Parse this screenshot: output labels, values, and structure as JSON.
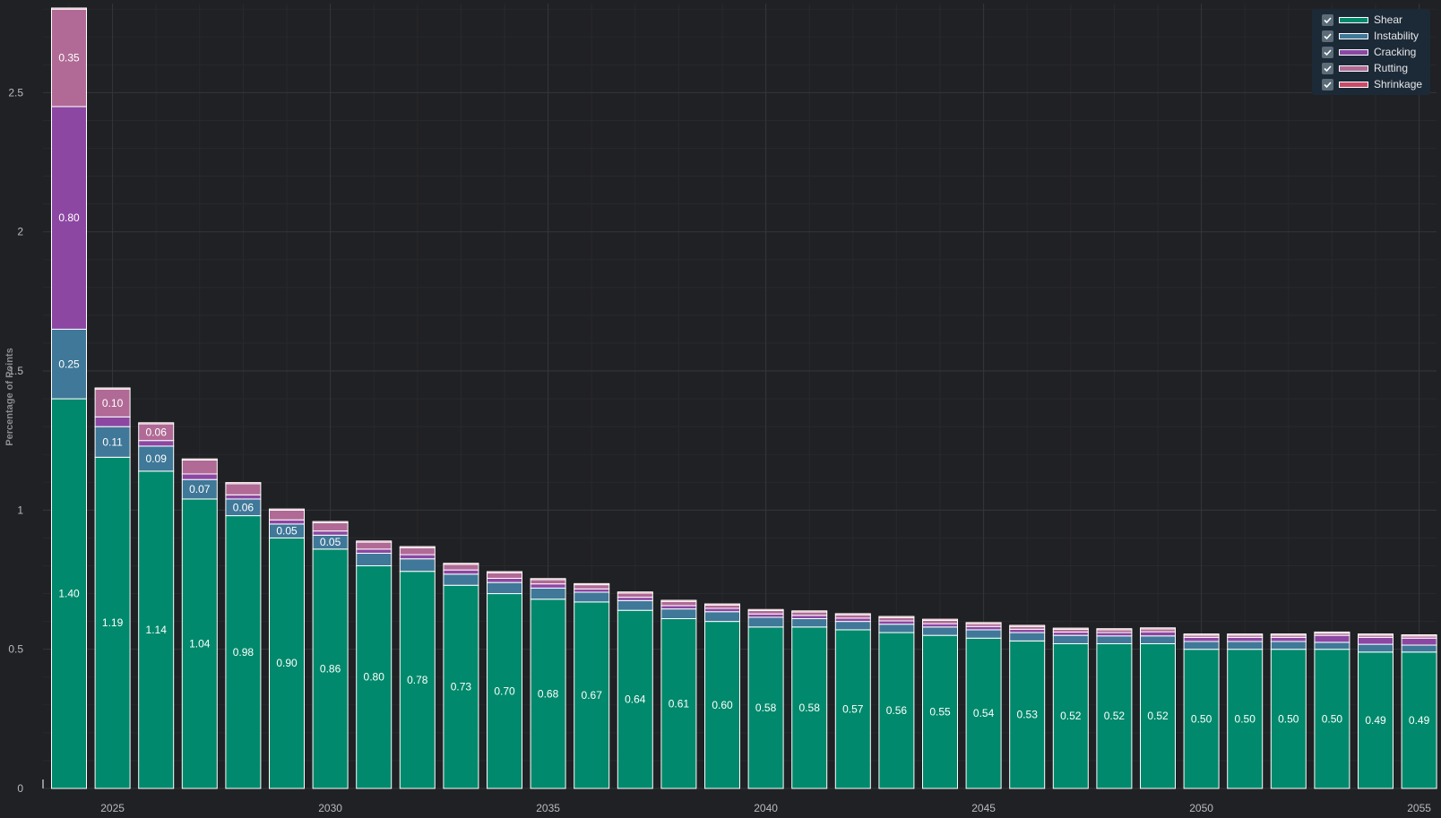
{
  "chart_data": {
    "type": "bar",
    "stacked": true,
    "ylabel": "Percentage of Points",
    "xlabel": "",
    "ylim": [
      0,
      2.82
    ],
    "yticks": [
      0,
      0.5,
      1,
      1.5,
      2,
      2.5
    ],
    "ytick_labels": [
      "0",
      "0.5",
      "1",
      "1.5",
      "2",
      "2.5"
    ],
    "xticks": [
      2025,
      2030,
      2035,
      2040,
      2045,
      2050,
      2055
    ],
    "categories": [
      2024,
      2025,
      2026,
      2027,
      2028,
      2029,
      2030,
      2031,
      2032,
      2033,
      2034,
      2035,
      2036,
      2037,
      2038,
      2039,
      2040,
      2041,
      2042,
      2043,
      2044,
      2045,
      2046,
      2047,
      2048,
      2049,
      2050,
      2051,
      2052,
      2053,
      2054,
      2055
    ],
    "series": [
      {
        "name": "Shear",
        "color": "#00896c",
        "values": [
          1.4,
          1.19,
          1.14,
          1.04,
          0.98,
          0.9,
          0.86,
          0.8,
          0.78,
          0.73,
          0.7,
          0.68,
          0.67,
          0.64,
          0.61,
          0.6,
          0.58,
          0.58,
          0.57,
          0.56,
          0.55,
          0.54,
          0.53,
          0.52,
          0.52,
          0.52,
          0.5,
          0.5,
          0.5,
          0.5,
          0.49,
          0.49
        ]
      },
      {
        "name": "Instability",
        "color": "#3f7898",
        "values": [
          0.25,
          0.11,
          0.09,
          0.07,
          0.06,
          0.05,
          0.05,
          0.045,
          0.045,
          0.04,
          0.04,
          0.04,
          0.035,
          0.035,
          0.035,
          0.035,
          0.035,
          0.03,
          0.03,
          0.03,
          0.03,
          0.03,
          0.03,
          0.03,
          0.028,
          0.028,
          0.028,
          0.028,
          0.028,
          0.025,
          0.028,
          0.025
        ]
      },
      {
        "name": "Cracking",
        "color": "#8c47a3",
        "values": [
          0.8,
          0.035,
          0.02,
          0.02,
          0.015,
          0.015,
          0.015,
          0.015,
          0.015,
          0.015,
          0.015,
          0.015,
          0.012,
          0.012,
          0.012,
          0.012,
          0.012,
          0.012,
          0.012,
          0.012,
          0.012,
          0.012,
          0.012,
          0.012,
          0.012,
          0.015,
          0.015,
          0.015,
          0.015,
          0.025,
          0.025,
          0.025
        ]
      },
      {
        "name": "Rutting",
        "color": "#b06a95",
        "values": [
          0.35,
          0.1,
          0.06,
          0.05,
          0.04,
          0.035,
          0.03,
          0.025,
          0.025,
          0.02,
          0.02,
          0.015,
          0.015,
          0.015,
          0.015,
          0.012,
          0.012,
          0.012,
          0.012,
          0.012,
          0.012,
          0.01,
          0.01,
          0.01,
          0.01,
          0.01,
          0.008,
          0.008,
          0.008,
          0.008,
          0.008,
          0.008
        ]
      },
      {
        "name": "Shrinkage",
        "color": "#c94b68",
        "values": [
          0.004,
          0.004,
          0.004,
          0.004,
          0.004,
          0.004,
          0.004,
          0.004,
          0.004,
          0.004,
          0.004,
          0.004,
          0.004,
          0.004,
          0.004,
          0.004,
          0.004,
          0.004,
          0.004,
          0.004,
          0.004,
          0.004,
          0.004,
          0.004,
          0.004,
          0.004,
          0.004,
          0.004,
          0.004,
          0.004,
          0.004,
          0.004
        ]
      }
    ],
    "data_labels": {
      "Shear": [
        "1.40",
        "1.19",
        "1.14",
        "1.04",
        "0.98",
        "0.90",
        "0.86",
        "0.80",
        "0.78",
        "0.73",
        "0.70",
        "0.68",
        "0.67",
        "0.64",
        "0.61",
        "0.60",
        "0.58",
        "0.58",
        "0.57",
        "0.56",
        "0.55",
        "0.54",
        "0.53",
        "0.52",
        "0.52",
        "0.52",
        "0.50",
        "0.50",
        "0.50",
        "0.50",
        "0.49",
        "0.49"
      ],
      "Instability": [
        "0.25",
        "0.11",
        "0.09",
        "0.07",
        "0.06",
        "0.05",
        "0.05",
        null,
        null,
        null,
        null,
        null,
        null,
        null,
        null,
        null,
        null,
        null,
        null,
        null,
        null,
        null,
        null,
        null,
        null,
        null,
        null,
        null,
        null,
        null,
        null,
        null
      ],
      "Cracking": [
        "0.80",
        null,
        null,
        null,
        null,
        null,
        null,
        null,
        null,
        null,
        null,
        null,
        null,
        null,
        null,
        null,
        null,
        null,
        null,
        null,
        null,
        null,
        null,
        null,
        null,
        null,
        null,
        null,
        null,
        null,
        null,
        null
      ],
      "Rutting": [
        "0.35",
        "0.10",
        "0.06",
        null,
        null,
        null,
        null,
        null,
        null,
        null,
        null,
        null,
        null,
        null,
        null,
        null,
        null,
        null,
        null,
        null,
        null,
        null,
        null,
        null,
        null,
        null,
        null,
        null,
        null,
        null,
        null,
        null
      ]
    },
    "grid": true,
    "legend_position": "top-right"
  },
  "legend": {
    "items": [
      {
        "label": "Shear",
        "color": "#00896c",
        "checked": true
      },
      {
        "label": "Instability",
        "color": "#3f7898",
        "checked": true
      },
      {
        "label": "Cracking",
        "color": "#8c47a3",
        "checked": true
      },
      {
        "label": "Rutting",
        "color": "#b06a95",
        "checked": true
      },
      {
        "label": "Shrinkage",
        "color": "#c94b68",
        "checked": true
      }
    ]
  }
}
